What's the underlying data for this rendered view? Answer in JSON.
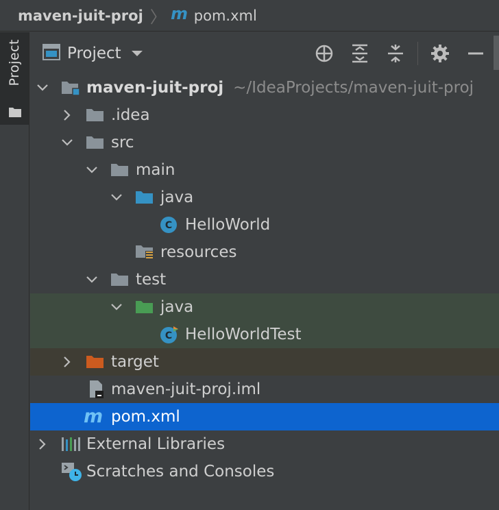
{
  "breadcrumb": {
    "project": "maven-juit-proj",
    "file": "pom.xml"
  },
  "stripe": {
    "tab_label": "Project"
  },
  "panel": {
    "title": "Project"
  },
  "tree": {
    "root": {
      "name": "maven-juit-proj",
      "path": "~/IdeaProjects/maven-juit-proj"
    },
    "idea": ".idea",
    "src": "src",
    "main": "main",
    "main_java": "java",
    "hello_world": "HelloWorld",
    "resources": "resources",
    "test": "test",
    "test_java": "java",
    "hello_world_test": "HelloWorldTest",
    "target": "target",
    "iml": "maven-juit-proj.iml",
    "pom": "pom.xml",
    "external_libraries": "External Libraries",
    "scratches": "Scratches and Consoles"
  },
  "colors": {
    "background": "#3c3f41",
    "selection": "#0d64cf",
    "folder_grey": "#8a939a",
    "folder_source": "#3592c4",
    "folder_test": "#499c54",
    "folder_excluded": "#cc5b1f",
    "class_icon": "#3592c4"
  }
}
